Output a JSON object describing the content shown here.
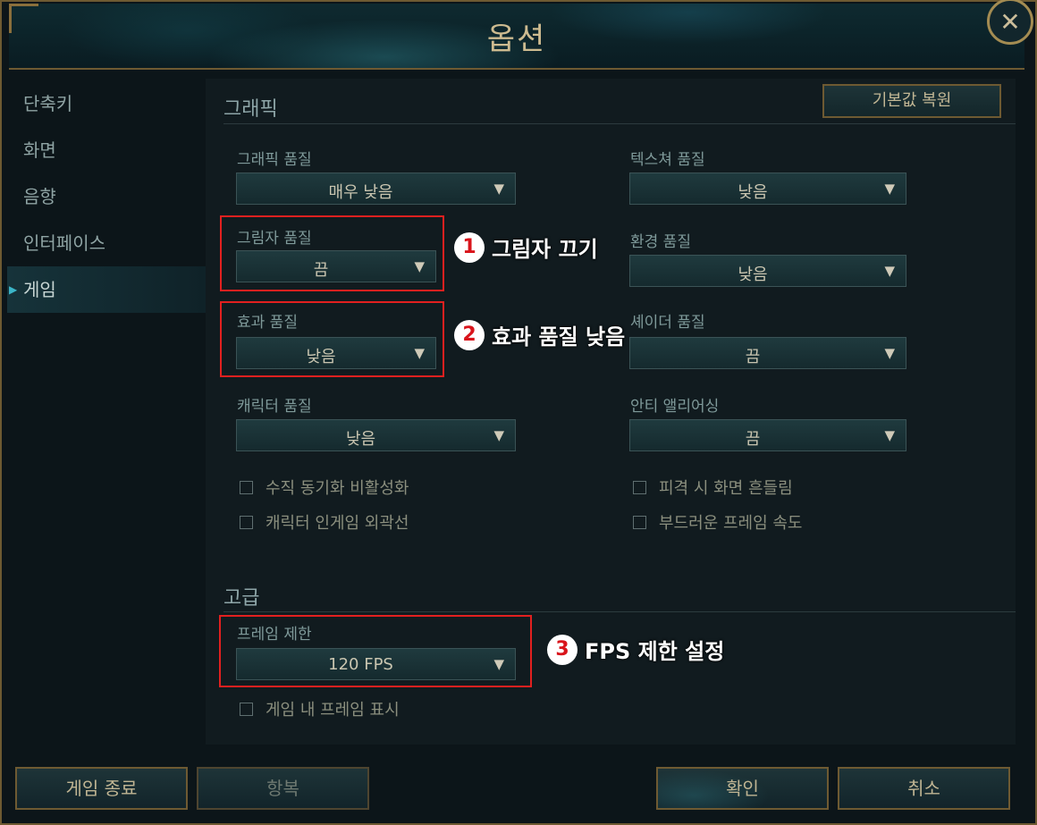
{
  "window": {
    "title": "옵션"
  },
  "sidebar": {
    "items": [
      {
        "label": "단축키"
      },
      {
        "label": "화면"
      },
      {
        "label": "음향"
      },
      {
        "label": "인터페이스"
      },
      {
        "label": "게임",
        "active": true
      }
    ]
  },
  "graphics": {
    "section_title": "그래픽",
    "restore_label": "기본값 복원",
    "graphics_quality": {
      "label": "그래픽 품질",
      "value": "매우 낮음"
    },
    "texture_quality": {
      "label": "텍스쳐 품질",
      "value": "낮음"
    },
    "shadow_quality": {
      "label": "그림자 품질",
      "value": "끔"
    },
    "environment_quality": {
      "label": "환경 품질",
      "value": "낮음"
    },
    "effects_quality": {
      "label": "효과 품질",
      "value": "낮음"
    },
    "shader_quality": {
      "label": "셰이더 품질",
      "value": "끔"
    },
    "character_quality": {
      "label": "캐릭터 품질",
      "value": "낮음"
    },
    "anti_aliasing": {
      "label": "안티 앨리어싱",
      "value": "끔"
    },
    "checkboxes": {
      "vsync": "수직 동기화 비활성화",
      "character_outline": "캐릭터 인게임 외곽선",
      "hit_shake": "피격 시 화면 흔들림",
      "smooth_framerate": "부드러운 프레임 속도"
    }
  },
  "advanced": {
    "section_title": "고급",
    "frame_limit": {
      "label": "프레임 제한",
      "value": "120 FPS"
    },
    "show_fps": "게임 내 프레임 표시"
  },
  "annotations": [
    {
      "num": "1",
      "text": "그림자 끄기"
    },
    {
      "num": "2",
      "text": "효과 품질 낮음"
    },
    {
      "num": "3",
      "text": "FPS 제한 설정"
    }
  ],
  "footer": {
    "quit_label": "게임 종료",
    "surrender_label": "항복",
    "ok_label": "확인",
    "cancel_label": "취소"
  },
  "colors": {
    "accent_gold": "#6e5a32",
    "annotation_red": "#e2201f",
    "active_arrow": "#3bb5c8"
  },
  "icons": {
    "close": "close-icon",
    "dropdown": "chevron-down-icon",
    "checkbox": "checkbox-icon"
  }
}
